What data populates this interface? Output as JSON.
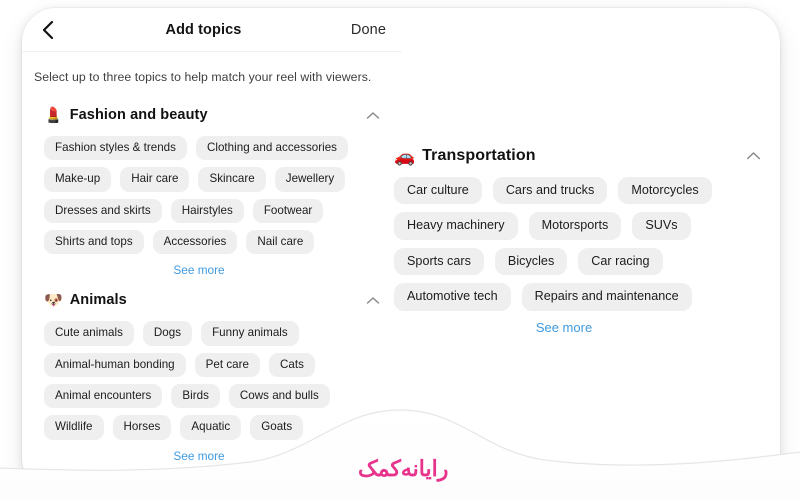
{
  "header": {
    "back_icon": "chevron-left-icon",
    "title": "Add topics",
    "done_label": "Done"
  },
  "subtitle": "Select up to three topics to help match your reel with viewers.",
  "see_more_label": "See more",
  "colors": {
    "chip_bg": "#efefef",
    "link_blue": "#3f9ae0",
    "text_dark": "#141414",
    "watermark_pink": "#e8338c",
    "card_bg": "#ffffff",
    "page_bg": "#ffffff"
  },
  "sections_left": [
    {
      "emoji": "💄",
      "emoji_name": "lipstick-icon",
      "title": "Fashion and beauty",
      "collapse_icon": "chevron-up-icon",
      "chips": [
        "Fashion styles & trends",
        "Clothing and accessories",
        "Make-up",
        "Hair care",
        "Skincare",
        "Jewellery",
        "Dresses and skirts",
        "Hairstyles",
        "Footwear",
        "Shirts and tops",
        "Accessories",
        "Nail care"
      ]
    },
    {
      "emoji": "🐶",
      "emoji_name": "dog-face-icon",
      "title": "Animals",
      "collapse_icon": "chevron-up-icon",
      "chips": [
        "Cute animals",
        "Dogs",
        "Funny animals",
        "Animal-human bonding",
        "Pet care",
        "Cats",
        "Animal encounters",
        "Birds",
        "Cows and bulls",
        "Wildlife",
        "Horses",
        "Aquatic",
        "Goats"
      ]
    }
  ],
  "sections_right": [
    {
      "emoji": "🚗",
      "emoji_name": "red-car-icon",
      "title": "Transportation",
      "collapse_icon": "chevron-up-icon",
      "chips": [
        "Car culture",
        "Cars and trucks",
        "Motorcycles",
        "Heavy machinery",
        "Motorsports",
        "SUVs",
        "Sports cars",
        "Bicycles",
        "Car racing",
        "Automotive tech",
        "Repairs and maintenance"
      ]
    }
  ],
  "watermark": {
    "text": "رایانه‌کمک"
  }
}
